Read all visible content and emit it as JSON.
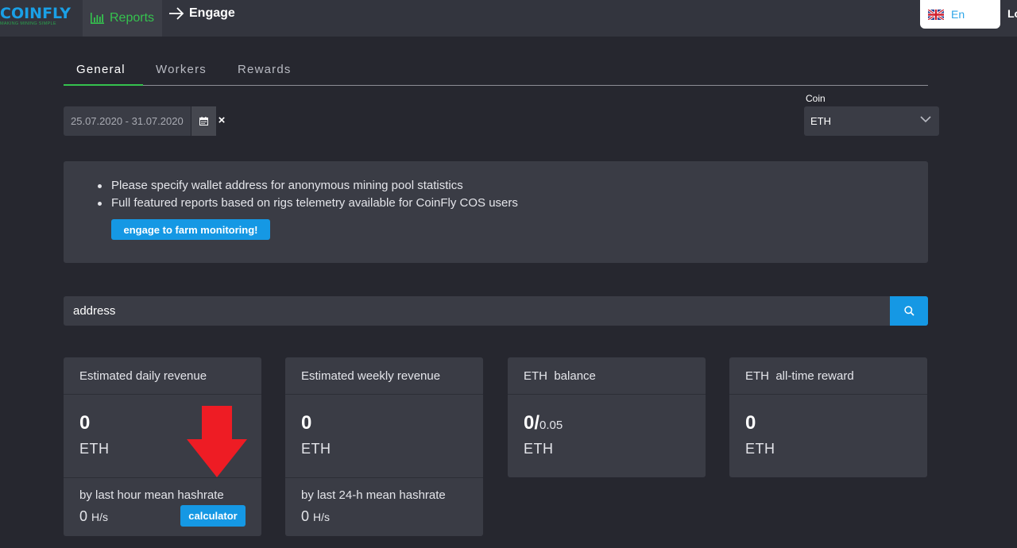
{
  "header": {
    "logo_text": "COINFLY",
    "logo_tagline": "MAKING MINING SIMPLE",
    "nav_reports": "Reports",
    "nav_engage": "Engage",
    "language": "En",
    "login": "Lo"
  },
  "tabs": [
    {
      "label": "General",
      "active": true
    },
    {
      "label": "Workers",
      "active": false
    },
    {
      "label": "Rewards",
      "active": false
    }
  ],
  "filters": {
    "date_range": "25.07.2020 - 31.07.2020",
    "clear_symbol": "×",
    "coin_label": "Coin",
    "coin_value": "ETH"
  },
  "notice": {
    "items": [
      "Please specify wallet address for anonymous mining pool statistics",
      "Full featured reports based on rigs telemetry available for CoinFly COS users"
    ],
    "button_label": "engage to farm monitoring!"
  },
  "search": {
    "placeholder": "address"
  },
  "cards": [
    {
      "title": "Estimated daily revenue",
      "value": "0",
      "unit": "ETH",
      "footer_label": "by last hour mean hashrate",
      "hashrate": "0",
      "hashrate_unit": "H/s",
      "button_label": "calculator"
    },
    {
      "title": "Estimated weekly revenue",
      "value": "0",
      "unit": "ETH",
      "footer_label": "by last 24-h mean hashrate",
      "hashrate": "0",
      "hashrate_unit": "H/s"
    },
    {
      "title": "ETH  balance",
      "value": "0/",
      "value_extra": "0.05",
      "unit": "ETH"
    },
    {
      "title": "ETH  all-time reward",
      "value": "0",
      "unit": "ETH"
    }
  ],
  "colors": {
    "accent_blue": "#1598e4",
    "accent_green": "#35c24e",
    "annotation_red": "#ee1c24"
  },
  "icons": [
    "bar-chart-icon",
    "arrow-right-icon",
    "uk-flag-icon",
    "calendar-icon",
    "chevron-down-icon",
    "search-icon",
    "red-down-arrow-annotation"
  ]
}
